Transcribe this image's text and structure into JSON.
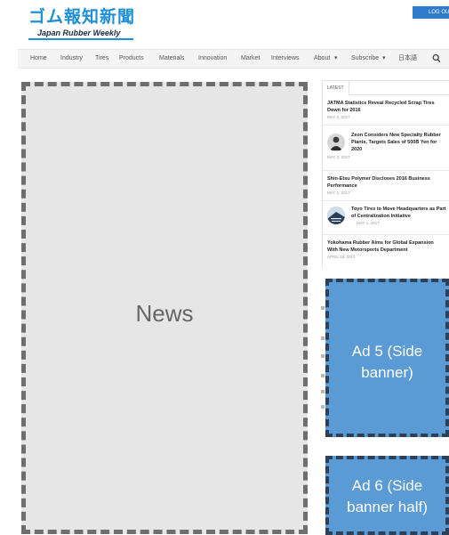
{
  "header": {
    "logo_jp": "ゴム報知新聞",
    "logo_en": "Japan Rubber Weekly",
    "logout_label": "LOG OUT"
  },
  "nav": {
    "items": [
      "Home",
      "Industry",
      "Tires",
      "Products",
      "Materials",
      "Innovation",
      "Market",
      "Interviews",
      "About",
      "Subscribe",
      "日本語"
    ],
    "dropdown_marker": "▾"
  },
  "news": {
    "label": "News"
  },
  "latest": {
    "tab_label": "LATEST",
    "items": [
      {
        "title_line1": "JATMA Statistics Reveal Recycled Scrap Tires",
        "title_line2": "Down for 2016",
        "title_line3": "",
        "date": "MAY 2, 2017"
      },
      {
        "title_line1": "Zeon Considers New Specialty Rubber",
        "title_line2": "Plants, Targets Sales of 500B Yen for",
        "title_line3": "2020",
        "date": "MAY 2, 2017"
      },
      {
        "title_line1": "Shin-Etsu Polymer Discloses 2016 Business",
        "title_line2": "Performance",
        "title_line3": "",
        "date": "MAY 1, 2017"
      },
      {
        "title_line1": "Toyo Tires to Move Headquarters as Part",
        "title_line2": "of Centralization Initiative",
        "title_line3": "",
        "date": "MAY 1, 2017"
      },
      {
        "title_line1": "Yokohama Rubber Aims for Global Expansion",
        "title_line2": "With New Motorsports Department",
        "title_line3": "",
        "date": "APRIL 28, 2017"
      }
    ]
  },
  "ads": {
    "ad5": {
      "line1": "Ad 5 (Side",
      "line2": "banner)"
    },
    "ad6": {
      "line1": "Ad 6 (Side",
      "line2": "banner half)"
    }
  },
  "colors": {
    "brand_blue": "#1f8fd6",
    "logout_blue": "#2f7bd0",
    "ad_blue": "#5b9bd5"
  }
}
